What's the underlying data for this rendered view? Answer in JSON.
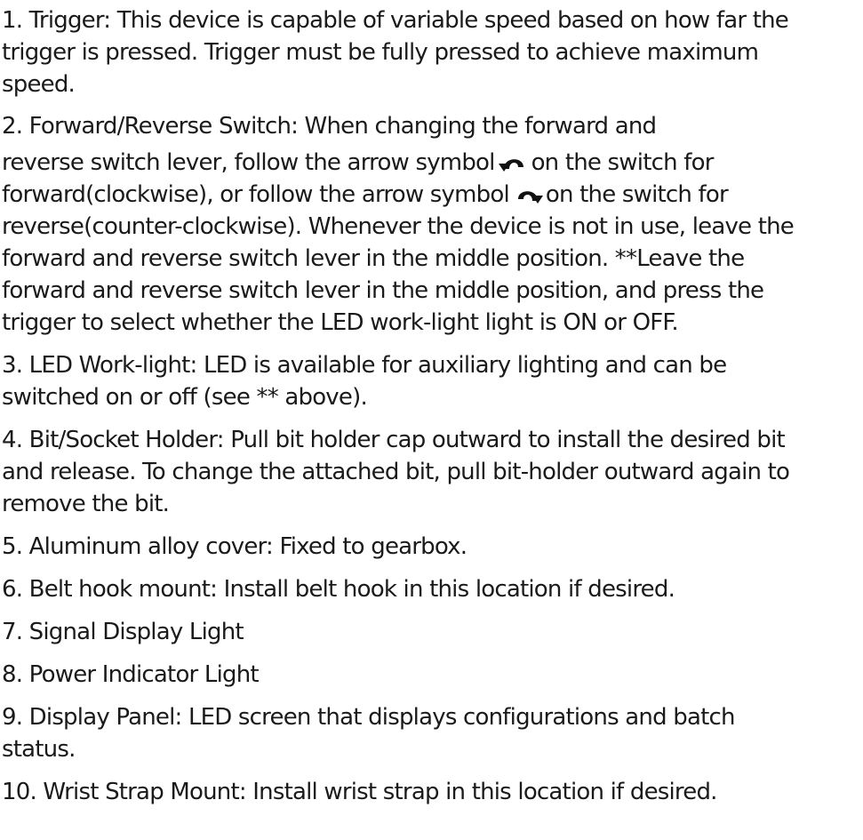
{
  "items": [
    {
      "lines": [
        "1. Trigger: This device is capable of variable speed based on how far the",
        "trigger is pressed. Trigger must be fully pressed to achieve maximum",
        "speed."
      ]
    },
    {
      "lines": [
        "2. Forward/Reverse Switch: When changing the forward and"
      ],
      "line2_before_icon": "reverse switch lever, follow the arrow symbol",
      "line2_after_icon": "on the switch for",
      "line3_before_icon": "forward(clockwise), or follow the arrow symbol",
      "line3_after_icon": "on the switch for",
      "lines_rest": [
        "reverse(counter-clockwise). Whenever the device is not in use, leave the",
        "forward and reverse switch lever in the middle position. **Leave the",
        "forward and reverse switch lever in the middle position, and press the",
        "trigger to select whether the LED work-light light is ON or OFF."
      ]
    },
    {
      "lines": [
        "3. LED Work-light: LED is available for auxiliary lighting and can be",
        "switched on or off (see ** above)."
      ]
    },
    {
      "lines": [
        "4. Bit/Socket Holder: Pull bit holder cap outward to install the desired bit",
        "and release. To change the attached bit, pull bit-holder outward again to",
        "remove the bit."
      ]
    },
    {
      "lines": [
        "5. Aluminum alloy cover: Fixed to gearbox."
      ]
    },
    {
      "lines": [
        "6. Belt hook mount: Install belt hook in this location if desired."
      ]
    },
    {
      "lines": [
        "7. Signal Display Light"
      ]
    },
    {
      "lines": [
        "8. Power Indicator Light"
      ]
    },
    {
      "lines": [
        "9. Display Panel: LED screen that displays configurations and batch",
        "status."
      ]
    },
    {
      "lines": [
        "10. Wrist Strap Mount: Install wrist strap in this location if desired."
      ]
    }
  ],
  "icons": {
    "forward": "counter-clockwise-arrow-icon",
    "reverse": "clockwise-arrow-icon"
  },
  "colors": {
    "text": "#1a1a1a",
    "background": "#ffffff"
  }
}
